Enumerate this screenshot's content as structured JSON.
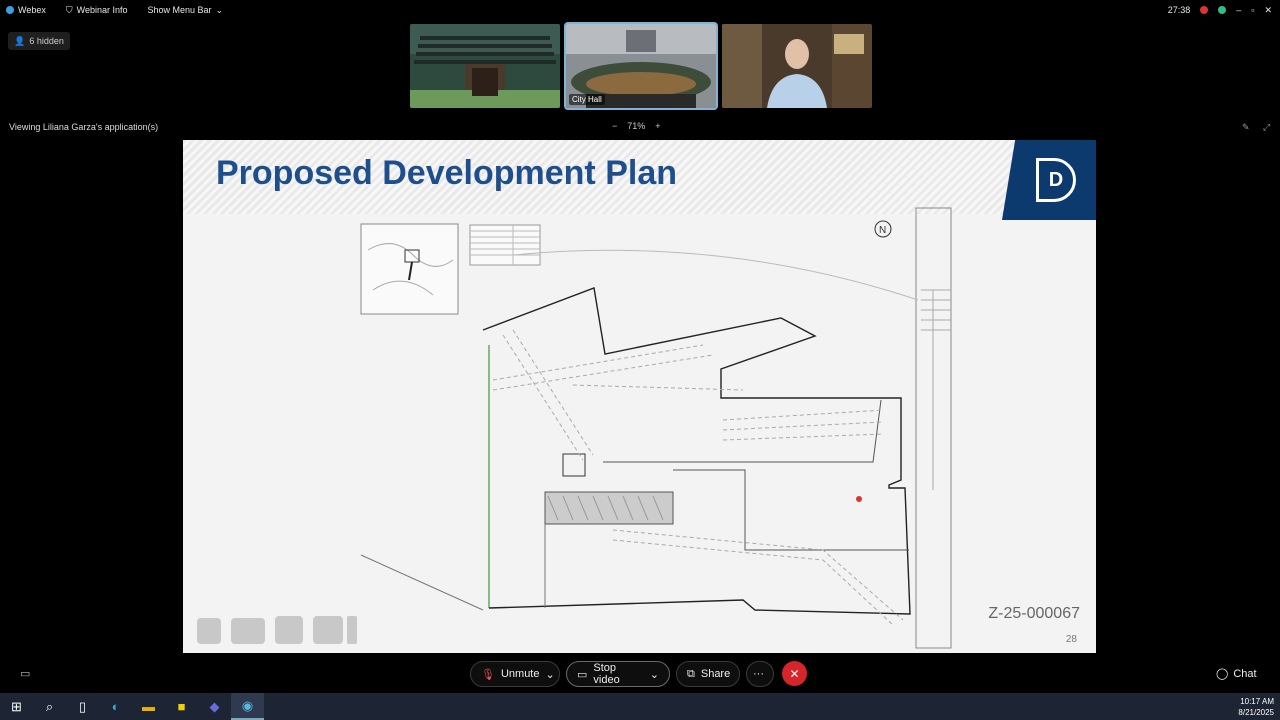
{
  "topbar": {
    "app_name": "Webex",
    "webinar_info": "Webinar Info",
    "show_menu_bar": "Show Menu Bar",
    "timer": "27:38"
  },
  "hidden_participants": "6 hidden",
  "video_tiles": [
    {
      "caption": ""
    },
    {
      "caption": "City Hall"
    },
    {
      "caption": ""
    }
  ],
  "viewing_label": "Viewing Liliana Garza's application(s)",
  "zoom": {
    "minus": "−",
    "level": "71%",
    "plus": "+"
  },
  "slide": {
    "title": "Proposed Development Plan",
    "case_number": "Z-25-000067",
    "page_number": "28",
    "north_label": "N",
    "logo_glyph": "D"
  },
  "controls": {
    "unmute": "Unmute",
    "stop_video": "Stop video",
    "share": "Share",
    "more": "···",
    "end": "✕",
    "chat": "Chat"
  },
  "taskbar": {
    "time": "10:17 AM",
    "date": "8/21/2025"
  },
  "colors": {
    "title_blue": "#1f4e8c",
    "logo_navy": "#0d3a6e",
    "end_red": "#d7262b"
  }
}
